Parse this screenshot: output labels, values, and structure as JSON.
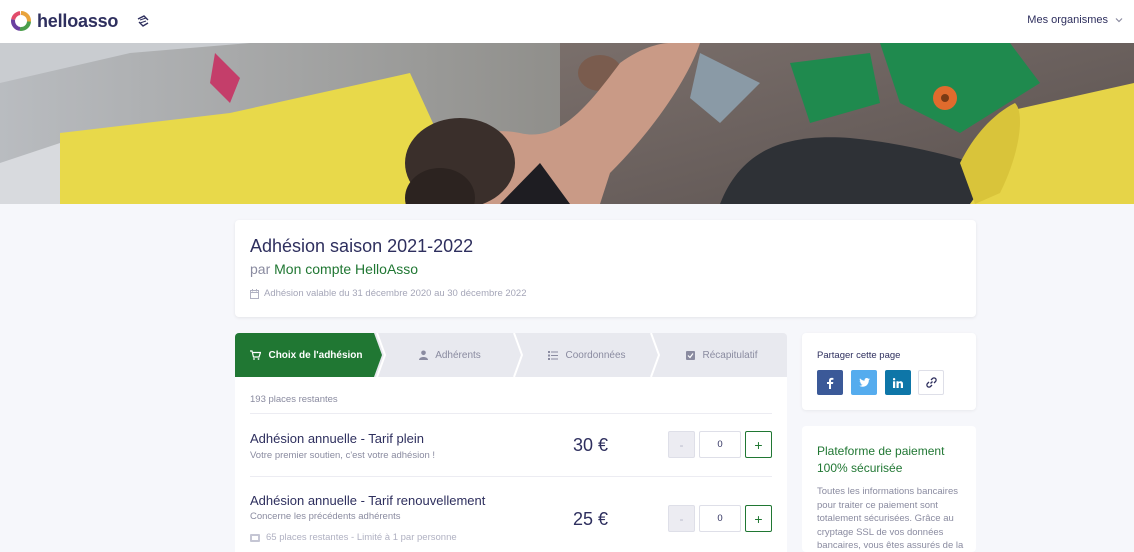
{
  "nav": {
    "logo_text": "helloasso",
    "org_menu_label": "Mes organismes"
  },
  "campaign": {
    "title": "Adhésion saison 2021-2022",
    "by_prefix": "par",
    "organization": "Mon compte HelloAsso",
    "validity": "Adhésion valable du 31 décembre 2020 au 30 décembre 2022"
  },
  "steps": [
    {
      "label": "Choix de l'adhésion",
      "icon": "cart-icon",
      "active": true
    },
    {
      "label": "Adhérents",
      "icon": "user-icon",
      "active": false
    },
    {
      "label": "Coordonnées",
      "icon": "list-icon",
      "active": false
    },
    {
      "label": "Récapitulatif",
      "icon": "check-square-icon",
      "active": false
    }
  ],
  "places_remaining": "193 places restantes",
  "items": [
    {
      "title": "Adhésion annuelle - Tarif plein",
      "subtitle": "Votre premier soutien, c'est votre adhésion !",
      "price": "30 €",
      "quantity": "0",
      "minus": "-",
      "plus": "+"
    },
    {
      "title": "Adhésion annuelle - Tarif renouvellement",
      "subtitle": "Concerne les précédents adhérents",
      "note": "65 places restantes - Limité à 1 par personne",
      "price": "25 €",
      "quantity": "0",
      "minus": "-",
      "plus": "+"
    }
  ],
  "share": {
    "label": "Partager cette page",
    "buttons": [
      {
        "icon": "facebook-icon",
        "color": "#3b5998"
      },
      {
        "icon": "twitter-icon",
        "color": "#55acee"
      },
      {
        "icon": "linkedin-icon",
        "color": "#0e76a8"
      },
      {
        "icon": "link-icon",
        "color": "#ffffff"
      }
    ]
  },
  "secure": {
    "title": "Plateforme de paiement 100% sécurisée",
    "text": "Toutes les informations bancaires pour traiter ce paiement sont totalement sécurisées. Grâce au cryptage SSL de vos données bancaires, vous êtes assurés de la"
  },
  "colors": {
    "brand_green": "#207733",
    "navy": "#2e2f5e",
    "page_bg": "#f6f7fb"
  }
}
